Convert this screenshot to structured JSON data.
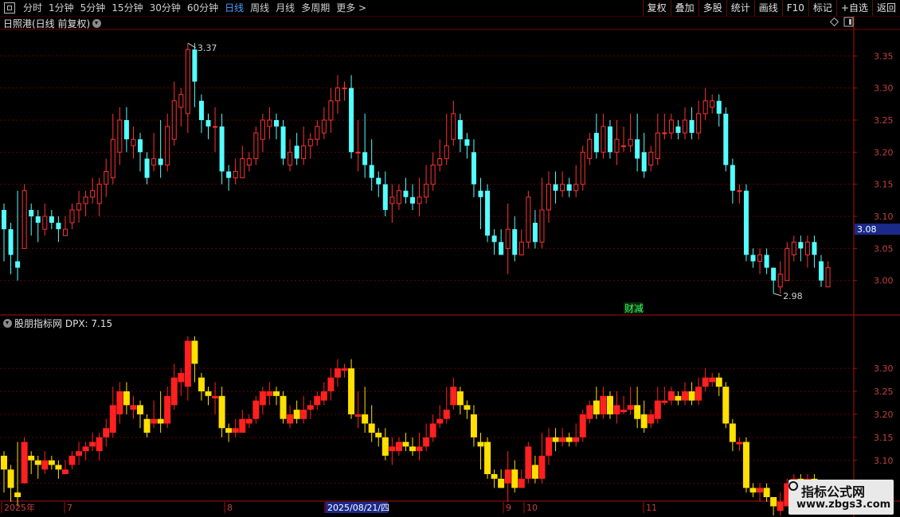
{
  "toolbar": {
    "periods": [
      "分时",
      "1分钟",
      "5分钟",
      "15分钟",
      "30分钟",
      "60分钟",
      "日线",
      "周线",
      "月线",
      "多周期",
      "更多 >"
    ],
    "active_period": "日线",
    "buttons": [
      "复权",
      "叠加",
      "多股",
      "统计",
      "画线",
      "F10",
      "标记",
      "+自选",
      "返回"
    ]
  },
  "main_panel": {
    "title": "日照港(日线 前复权)",
    "high_label": "3.37",
    "low_label": "2.98",
    "current_price": "3.08",
    "annotation": "财减",
    "axis_labels": [
      "3.35",
      "3.30",
      "3.25",
      "3.20",
      "3.15",
      "3.10",
      "3.05",
      "3.00"
    ]
  },
  "indicator_panel": {
    "title": "股朋指标网",
    "value_text": "DPX: 7.15",
    "axis_labels": [
      "3.30",
      "3.25",
      "3.20",
      "3.15",
      "3.10",
      "3.05"
    ]
  },
  "date_axis": {
    "labels": [
      "2025年",
      "7",
      "8",
      "2025/08/21/四",
      "9",
      "10",
      "11"
    ]
  },
  "watermark": {
    "line1": "指标公式网",
    "line2": "www.zbgs3.com"
  },
  "colors": {
    "up": "#ff3232",
    "down": "#54ffff",
    "ind_up": "#ff2020",
    "ind_down": "#ffe000",
    "grid": "#6a0000"
  },
  "chart_data": {
    "type": "candlestick",
    "series": [
      {
        "values": [
          [
            3.11,
            3.08,
            3.12,
            3.03
          ],
          [
            3.08,
            3.04,
            3.09,
            3.01
          ],
          [
            3.03,
            3.02,
            3.14,
            3.0
          ],
          [
            3.05,
            3.14,
            3.15,
            3.05
          ],
          [
            3.11,
            3.1,
            3.12,
            3.07
          ],
          [
            3.1,
            3.09,
            3.11,
            3.06
          ],
          [
            3.08,
            3.1,
            3.12,
            3.07
          ],
          [
            3.1,
            3.09,
            3.11,
            3.08
          ],
          [
            3.09,
            3.08,
            3.1,
            3.06
          ],
          [
            3.07,
            3.08,
            3.1,
            3.07
          ],
          [
            3.09,
            3.11,
            3.12,
            3.08
          ],
          [
            3.11,
            3.12,
            3.14,
            3.09
          ],
          [
            3.12,
            3.13,
            3.14,
            3.1
          ],
          [
            3.13,
            3.14,
            3.16,
            3.12
          ],
          [
            3.12,
            3.15,
            3.16,
            3.1
          ],
          [
            3.15,
            3.17,
            3.19,
            3.13
          ],
          [
            3.16,
            3.22,
            3.26,
            3.15
          ],
          [
            3.2,
            3.25,
            3.27,
            3.18
          ],
          [
            3.25,
            3.22,
            3.27,
            3.2
          ],
          [
            3.21,
            3.22,
            3.24,
            3.19
          ],
          [
            3.22,
            3.2,
            3.23,
            3.17
          ],
          [
            3.19,
            3.16,
            3.2,
            3.15
          ],
          [
            3.18,
            3.19,
            3.23,
            3.17
          ],
          [
            3.19,
            3.18,
            3.25,
            3.16
          ],
          [
            3.18,
            3.24,
            3.26,
            3.17
          ],
          [
            3.22,
            3.28,
            3.31,
            3.21
          ],
          [
            3.27,
            3.29,
            3.3,
            3.24
          ],
          [
            3.26,
            3.36,
            3.37,
            3.23
          ],
          [
            3.36,
            3.31,
            3.37,
            3.27
          ],
          [
            3.28,
            3.25,
            3.29,
            3.23
          ],
          [
            3.25,
            3.24,
            3.26,
            3.22
          ],
          [
            3.24,
            3.24,
            3.27,
            3.2
          ],
          [
            3.24,
            3.17,
            3.26,
            3.15
          ],
          [
            3.17,
            3.16,
            3.18,
            3.14
          ],
          [
            3.16,
            3.17,
            3.19,
            3.15
          ],
          [
            3.16,
            3.19,
            3.21,
            3.16
          ],
          [
            3.18,
            3.19,
            3.2,
            3.17
          ],
          [
            3.19,
            3.23,
            3.24,
            3.18
          ],
          [
            3.22,
            3.25,
            3.26,
            3.2
          ],
          [
            3.24,
            3.25,
            3.27,
            3.22
          ],
          [
            3.25,
            3.24,
            3.26,
            3.22
          ],
          [
            3.24,
            3.19,
            3.25,
            3.18
          ],
          [
            3.18,
            3.2,
            3.22,
            3.17
          ],
          [
            3.21,
            3.19,
            3.23,
            3.18
          ],
          [
            3.19,
            3.21,
            3.24,
            3.18
          ],
          [
            3.21,
            3.22,
            3.23,
            3.19
          ],
          [
            3.22,
            3.24,
            3.25,
            3.21
          ],
          [
            3.23,
            3.25,
            3.27,
            3.22
          ],
          [
            3.25,
            3.28,
            3.3,
            3.23
          ],
          [
            3.28,
            3.3,
            3.32,
            3.26
          ],
          [
            3.3,
            3.3,
            3.31,
            3.28
          ],
          [
            3.3,
            3.2,
            3.32,
            3.19
          ],
          [
            3.2,
            3.2,
            3.25,
            3.17
          ],
          [
            3.2,
            3.18,
            3.26,
            3.16
          ],
          [
            3.18,
            3.16,
            3.22,
            3.14
          ],
          [
            3.16,
            3.15,
            3.17,
            3.13
          ],
          [
            3.15,
            3.11,
            3.17,
            3.1
          ],
          [
            3.12,
            3.13,
            3.15,
            3.09
          ],
          [
            3.12,
            3.14,
            3.15,
            3.11
          ],
          [
            3.14,
            3.13,
            3.16,
            3.12
          ],
          [
            3.13,
            3.12,
            3.15,
            3.11
          ],
          [
            3.12,
            3.13,
            3.16,
            3.1
          ],
          [
            3.13,
            3.15,
            3.18,
            3.12
          ],
          [
            3.15,
            3.18,
            3.2,
            3.14
          ],
          [
            3.18,
            3.19,
            3.22,
            3.17
          ],
          [
            3.19,
            3.21,
            3.26,
            3.18
          ],
          [
            3.22,
            3.26,
            3.28,
            3.21
          ],
          [
            3.25,
            3.22,
            3.26,
            3.2
          ],
          [
            3.22,
            3.21,
            3.23,
            3.19
          ],
          [
            3.2,
            3.15,
            3.22,
            3.13
          ],
          [
            3.14,
            3.13,
            3.16,
            3.08
          ],
          [
            3.14,
            3.07,
            3.15,
            3.06
          ],
          [
            3.07,
            3.06,
            3.08,
            3.04
          ],
          [
            3.06,
            3.04,
            3.08,
            3.04
          ],
          [
            3.05,
            3.08,
            3.12,
            3.01
          ],
          [
            3.08,
            3.04,
            3.1,
            3.03
          ],
          [
            3.04,
            3.06,
            3.08,
            3.04
          ],
          [
            3.06,
            3.13,
            3.14,
            3.05
          ],
          [
            3.09,
            3.06,
            3.11,
            3.05
          ],
          [
            3.06,
            3.11,
            3.16,
            3.05
          ],
          [
            3.11,
            3.15,
            3.17,
            3.09
          ],
          [
            3.15,
            3.14,
            3.17,
            3.12
          ],
          [
            3.14,
            3.15,
            3.17,
            3.13
          ],
          [
            3.15,
            3.14,
            3.16,
            3.13
          ],
          [
            3.14,
            3.15,
            3.18,
            3.13
          ],
          [
            3.15,
            3.2,
            3.21,
            3.14
          ],
          [
            3.19,
            3.22,
            3.23,
            3.18
          ],
          [
            3.23,
            3.2,
            3.26,
            3.19
          ],
          [
            3.2,
            3.24,
            3.26,
            3.19
          ],
          [
            3.24,
            3.2,
            3.25,
            3.19
          ],
          [
            3.2,
            3.22,
            3.25,
            3.18
          ],
          [
            3.21,
            3.21,
            3.24,
            3.2
          ],
          [
            3.21,
            3.22,
            3.26,
            3.2
          ],
          [
            3.22,
            3.19,
            3.26,
            3.17
          ],
          [
            3.2,
            3.17,
            3.23,
            3.16
          ],
          [
            3.18,
            3.2,
            3.21,
            3.17
          ],
          [
            3.19,
            3.23,
            3.26,
            3.18
          ],
          [
            3.23,
            3.23,
            3.26,
            3.22
          ],
          [
            3.23,
            3.25,
            3.26,
            3.22
          ],
          [
            3.24,
            3.23,
            3.25,
            3.22
          ],
          [
            3.23,
            3.25,
            3.27,
            3.22
          ],
          [
            3.25,
            3.23,
            3.27,
            3.22
          ],
          [
            3.23,
            3.26,
            3.28,
            3.22
          ],
          [
            3.26,
            3.28,
            3.3,
            3.25
          ],
          [
            3.27,
            3.28,
            3.29,
            3.26
          ],
          [
            3.28,
            3.26,
            3.29,
            3.24
          ],
          [
            3.26,
            3.18,
            3.27,
            3.17
          ],
          [
            3.18,
            3.14,
            3.19,
            3.12
          ],
          [
            3.14,
            3.14,
            3.15,
            3.12
          ],
          [
            3.14,
            3.04,
            3.15,
            3.03
          ],
          [
            3.04,
            3.03,
            3.05,
            3.02
          ],
          [
            3.03,
            3.04,
            3.05,
            3.01
          ],
          [
            3.04,
            3.02,
            3.05,
            3.01
          ],
          [
            3.02,
            3.0,
            3.02,
            2.98
          ],
          [
            2.99,
            3.01,
            3.03,
            2.98
          ],
          [
            3.0,
            3.05,
            3.06,
            3.0
          ],
          [
            3.04,
            3.06,
            3.07,
            3.03
          ],
          [
            3.06,
            3.05,
            3.07,
            3.03
          ],
          [
            3.04,
            3.06,
            3.07,
            3.02
          ],
          [
            3.06,
            3.04,
            3.07,
            3.02
          ],
          [
            3.03,
            3.0,
            3.04,
            2.99
          ],
          [
            2.99,
            3.02,
            3.03,
            2.99
          ]
        ]
      }
    ],
    "ylim": [
      2.96,
      3.39
    ],
    "indicator_ylim": [
      3.02,
      3.34
    ]
  }
}
